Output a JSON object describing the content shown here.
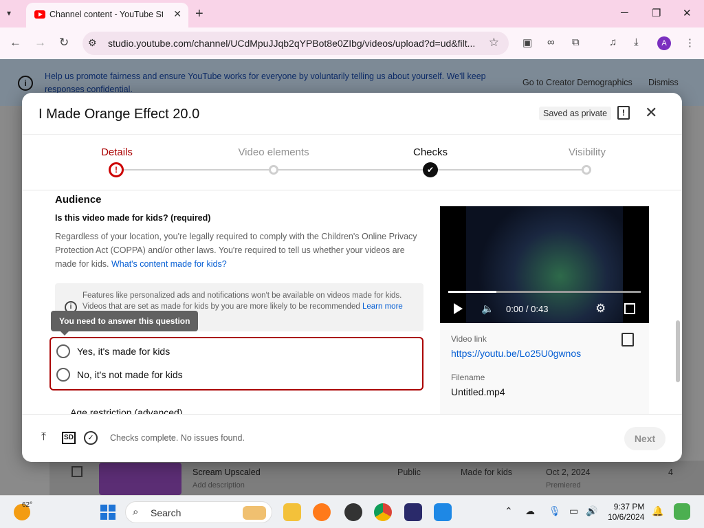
{
  "browser": {
    "tab_title": "Channel content - YouTube Studio",
    "url": "studio.youtube.com/channel/UCdMpuJJqb2qYPBot8e0ZIbg/videos/upload?d=ud&filt...",
    "avatar_letter": "A",
    "win_min": "─",
    "win_max": "❐",
    "win_close": "✕"
  },
  "banner": {
    "text": "Help us promote fairness and ensure YouTube works for everyone by voluntarily telling us about yourself. We'll keep responses confidential.",
    "demographics_btn": "Go to Creator Demographics",
    "dismiss_btn": "Dismiss"
  },
  "background_row": {
    "title": "Scream Upscaled",
    "subtitle": "Add description",
    "visibility": "Public",
    "audience": "Made for kids",
    "date": "Oct 2, 2024",
    "date_sub": "Premiered",
    "count": "4"
  },
  "dialog": {
    "title": "I Made Orange Effect 20.0",
    "saved_badge": "Saved as private",
    "steps": [
      {
        "label": "Details",
        "state": "error"
      },
      {
        "label": "Video elements",
        "state": "pending"
      },
      {
        "label": "Checks",
        "state": "done"
      },
      {
        "label": "Visibility",
        "state": "pending"
      }
    ],
    "audience": {
      "section_title": "Audience",
      "question": "Is this video made for kids? (required)",
      "description": "Regardless of your location, you're legally required to comply with the Children's Online Privacy Protection Act (COPPA) and/or other laws. You're required to tell us whether your videos are made for kids.",
      "description_link": "What's content made for kids?",
      "notice": "Features like personalized ads and notifications won't be available on videos made for kids. Videos that are set as made for kids by you are more likely to be recommended",
      "notice_link": "Learn more",
      "tooltip": "You need to answer this question",
      "option_yes": "Yes, it's made for kids",
      "option_no": "No, it's not made for kids",
      "age_restriction": "Age restriction (advanced)"
    },
    "player": {
      "time": "0:00 / 0:43",
      "progress_fraction": 0.25
    },
    "video_info": {
      "link_label": "Video link",
      "link_value": "https://youtu.be/Lo25U0gwnos",
      "filename_label": "Filename",
      "filename_value": "Untitled.mp4"
    },
    "footer": {
      "sd_badge": "SD",
      "status": "Checks complete. No issues found.",
      "next_btn": "Next"
    }
  },
  "taskbar": {
    "temperature": "62°",
    "search_text": "Search",
    "time": "9:37 PM",
    "date": "10/6/2024"
  },
  "colors": {
    "error_red": "#cc0000",
    "link_blue": "#065fd4",
    "youtube_red": "#ff0000"
  }
}
